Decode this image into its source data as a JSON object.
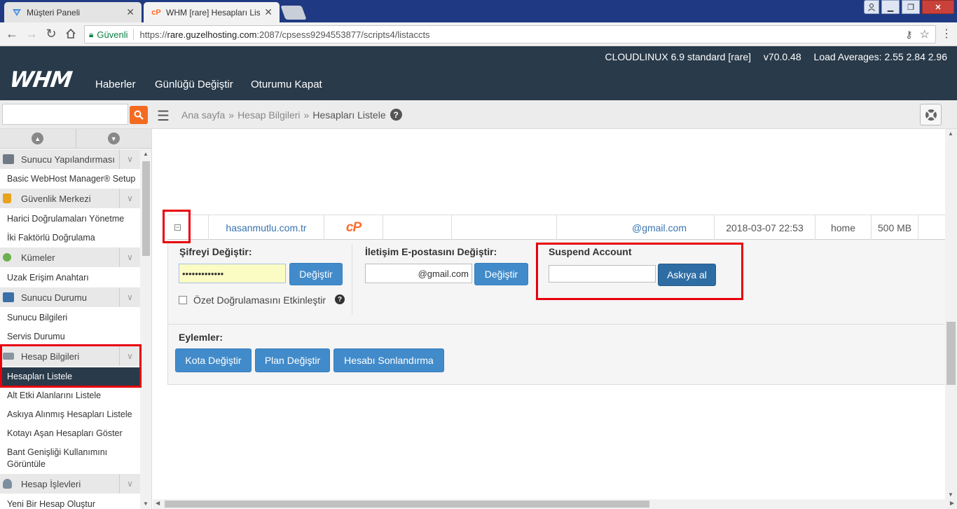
{
  "browser": {
    "tabs": [
      {
        "title": "Müşteri Paneli",
        "active": false
      },
      {
        "title": "WHM [rare] Hesapları List",
        "active": true
      }
    ],
    "address": {
      "secure_label": "Güvenli",
      "url_prefix": "https://",
      "url_host": "rare.guzelhosting.com",
      "url_rest": ":2087/cpsess9294553877/scripts4/listaccts"
    }
  },
  "whm": {
    "logo": "WHM",
    "nav": [
      "Haberler",
      "Günlüğü Değiştir",
      "Oturumu Kapat"
    ],
    "sysinfo": {
      "os": "CLOUDLINUX 6.9 standard [rare]",
      "version": "v70.0.48",
      "load": "Load Averages: 2.55 2.84 2.96"
    }
  },
  "breadcrumb": {
    "home": "Ana sayfa",
    "section": "Hesap Bilgileri",
    "current": "Hesapları Listele"
  },
  "sidebar": {
    "categories": [
      {
        "label": "Sunucu Yapılandırması",
        "icon": "server-icon"
      },
      {
        "label": "Güvenlik Merkezi",
        "icon": "lock-icon"
      },
      {
        "label": "Kümeler",
        "icon": "cluster-icon"
      },
      {
        "label": "Sunucu Durumu",
        "icon": "monitor-icon"
      },
      {
        "label": "Hesap Bilgileri",
        "icon": "account-info-icon"
      },
      {
        "label": "Hesap İşlevleri",
        "icon": "user-icon"
      }
    ],
    "items": {
      "basic_setup": "Basic WebHost Manager® Setup",
      "external_auth": "Harici Doğrulamaları Yönetme",
      "two_factor": "İki Faktörlü Doğrulama",
      "remote_key": "Uzak Erişim Anahtarı",
      "server_info": "Sunucu Bilgileri",
      "service_status": "Servis Durumu",
      "list_accounts": "Hesapları Listele",
      "list_subdomains": "Alt Etki Alanlarını Listele",
      "list_suspended": "Askıya Alınmış Hesapları Listele",
      "over_quota": "Kotayı Aşan Hesapları Göster",
      "bandwidth_line1": "Bant Genişliği Kullanımını",
      "bandwidth_line2": "Görüntüle",
      "create_account": "Yeni Bir Hesap Oluştur"
    }
  },
  "account": {
    "domain": "hasanmutlu.com.tr",
    "email": "@gmail.com",
    "date": "2018-03-07 22:53",
    "partition": "home",
    "quota": "500 MB"
  },
  "password_form": {
    "label": "Şifreyi Değiştir:",
    "value": "•••••••••••••",
    "button": "Değiştir",
    "digest_label": "Özet Doğrulamasını Etkinleştir"
  },
  "email_form": {
    "label": "İletişim E-postasını Değiştir:",
    "value": "@gmail.com",
    "button": "Değiştir"
  },
  "suspend_form": {
    "label": "Suspend Account",
    "value": "",
    "button": "Askıya al"
  },
  "actions": {
    "label": "Eylemler:",
    "buttons": [
      "Kota Değiştir",
      "Plan Değiştir",
      "Hesabı Sonlandırma"
    ]
  },
  "colors": {
    "header_bg": "#293a4a",
    "highlight": "#e8000b",
    "button_blue": "#428bca",
    "search_orange": "#f36b21",
    "cpanel_orange": "#ff6c2c"
  }
}
